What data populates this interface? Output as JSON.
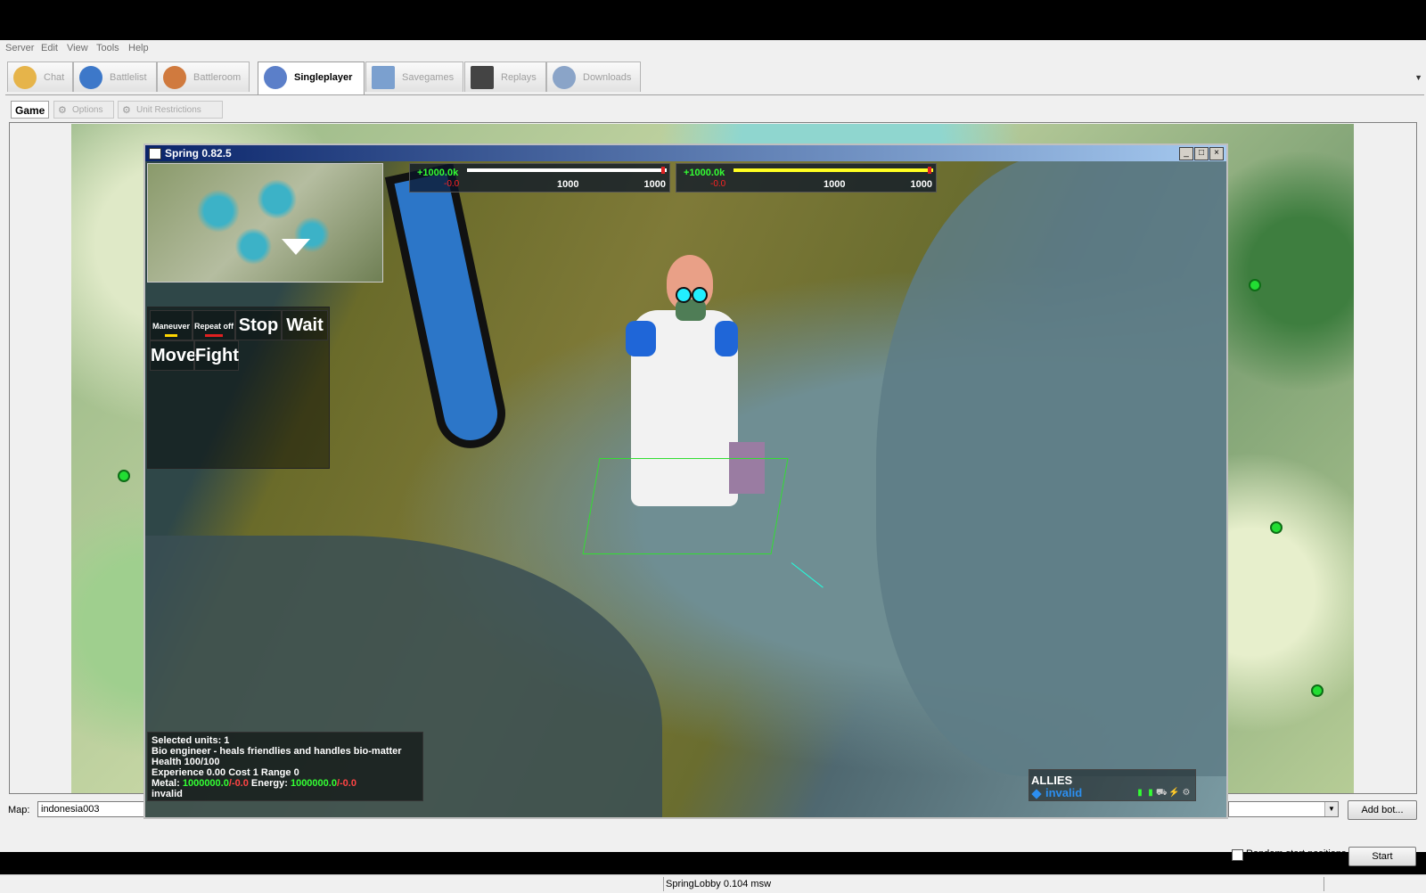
{
  "menu": [
    "Server",
    "Edit",
    "View",
    "Tools",
    "Help"
  ],
  "tabs": [
    {
      "label": "Chat",
      "icon": "chat-icon",
      "active": false
    },
    {
      "label": "Battlelist",
      "icon": "globe-icon",
      "active": false
    },
    {
      "label": "Battleroom",
      "icon": "people-icon",
      "active": false
    },
    {
      "label": "Singleplayer",
      "icon": "singleplayer-icon",
      "active": true
    },
    {
      "label": "Savegames",
      "icon": "floppy-disk-icon",
      "active": false
    },
    {
      "label": "Replays",
      "icon": "clapperboard-icon",
      "active": false
    },
    {
      "label": "Downloads",
      "icon": "download-globe-icon",
      "active": false
    }
  ],
  "subtabs": [
    {
      "label": "Game",
      "active": true
    },
    {
      "label": "Options",
      "active": false
    },
    {
      "label": "Unit Restrictions",
      "active": false
    }
  ],
  "map_row": {
    "label": "Map:",
    "map_value": "indonesia003",
    "add_bot_label": "Add bot...",
    "random_start_label": "Random start positions",
    "random_start_checked": false,
    "start_label": "Start"
  },
  "status_bar": {
    "text": "SpringLobby 0.104 msw"
  },
  "spring_window": {
    "title": "Spring 0.82.5",
    "metal": {
      "income": "+1000.0k",
      "expense": "-0.0",
      "current": "1000",
      "max": "1000",
      "level": 0.98,
      "bar_color": "#ffffff"
    },
    "energy": {
      "income": "+1000.0k",
      "expense": "-0.0",
      "current": "1000",
      "max": "1000",
      "level": 0.98,
      "bar_color": "#ffff22"
    },
    "orders": {
      "maneuver": "Maneuver",
      "repeat": "Repeat off",
      "stop": "Stop",
      "wait": "Wait",
      "move": "Move",
      "fight": "Fight"
    },
    "unit_info": {
      "selected": "Selected units: 1",
      "description": "Bio engineer - heals friendlies and handles bio-matter",
      "health": "Health 100/100",
      "stats": "Experience 0.00 Cost 1 Range 0",
      "metal_label": "Metal:",
      "metal_value": "1000000.0",
      "metal_delta": "/-0.0",
      "energy_label": "Energy:",
      "energy_value": "1000000.0",
      "energy_delta": "/-0.0",
      "owner": "invalid"
    },
    "allies": {
      "title": "ALLIES",
      "player": "invalid"
    }
  },
  "colors": {
    "accent_title": "#0a246a",
    "start_marker": "#22dd33"
  }
}
